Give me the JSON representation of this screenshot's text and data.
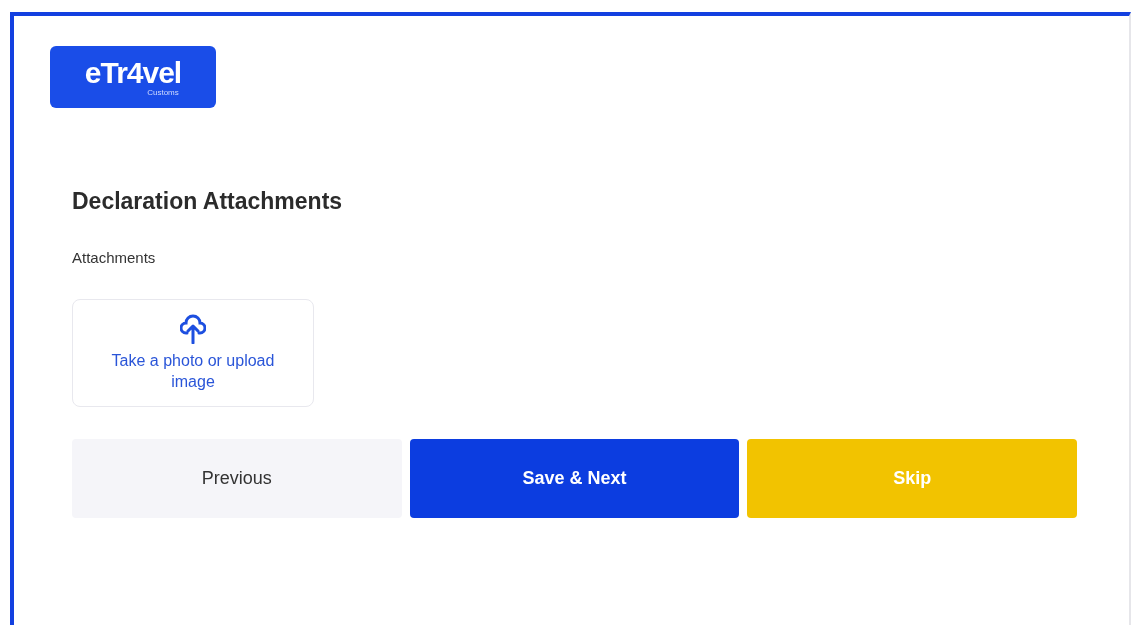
{
  "logo": {
    "name": "eTr4vel",
    "sub": "Customs"
  },
  "section": {
    "title": "Declaration Attachments",
    "label": "Attachments"
  },
  "upload": {
    "text": "Take a photo or upload image"
  },
  "buttons": [
    {
      "label": "Previous",
      "kind": "secondary"
    },
    {
      "label": "Save & Next",
      "kind": "primary"
    },
    {
      "label": "Skip",
      "kind": "warning"
    }
  ]
}
